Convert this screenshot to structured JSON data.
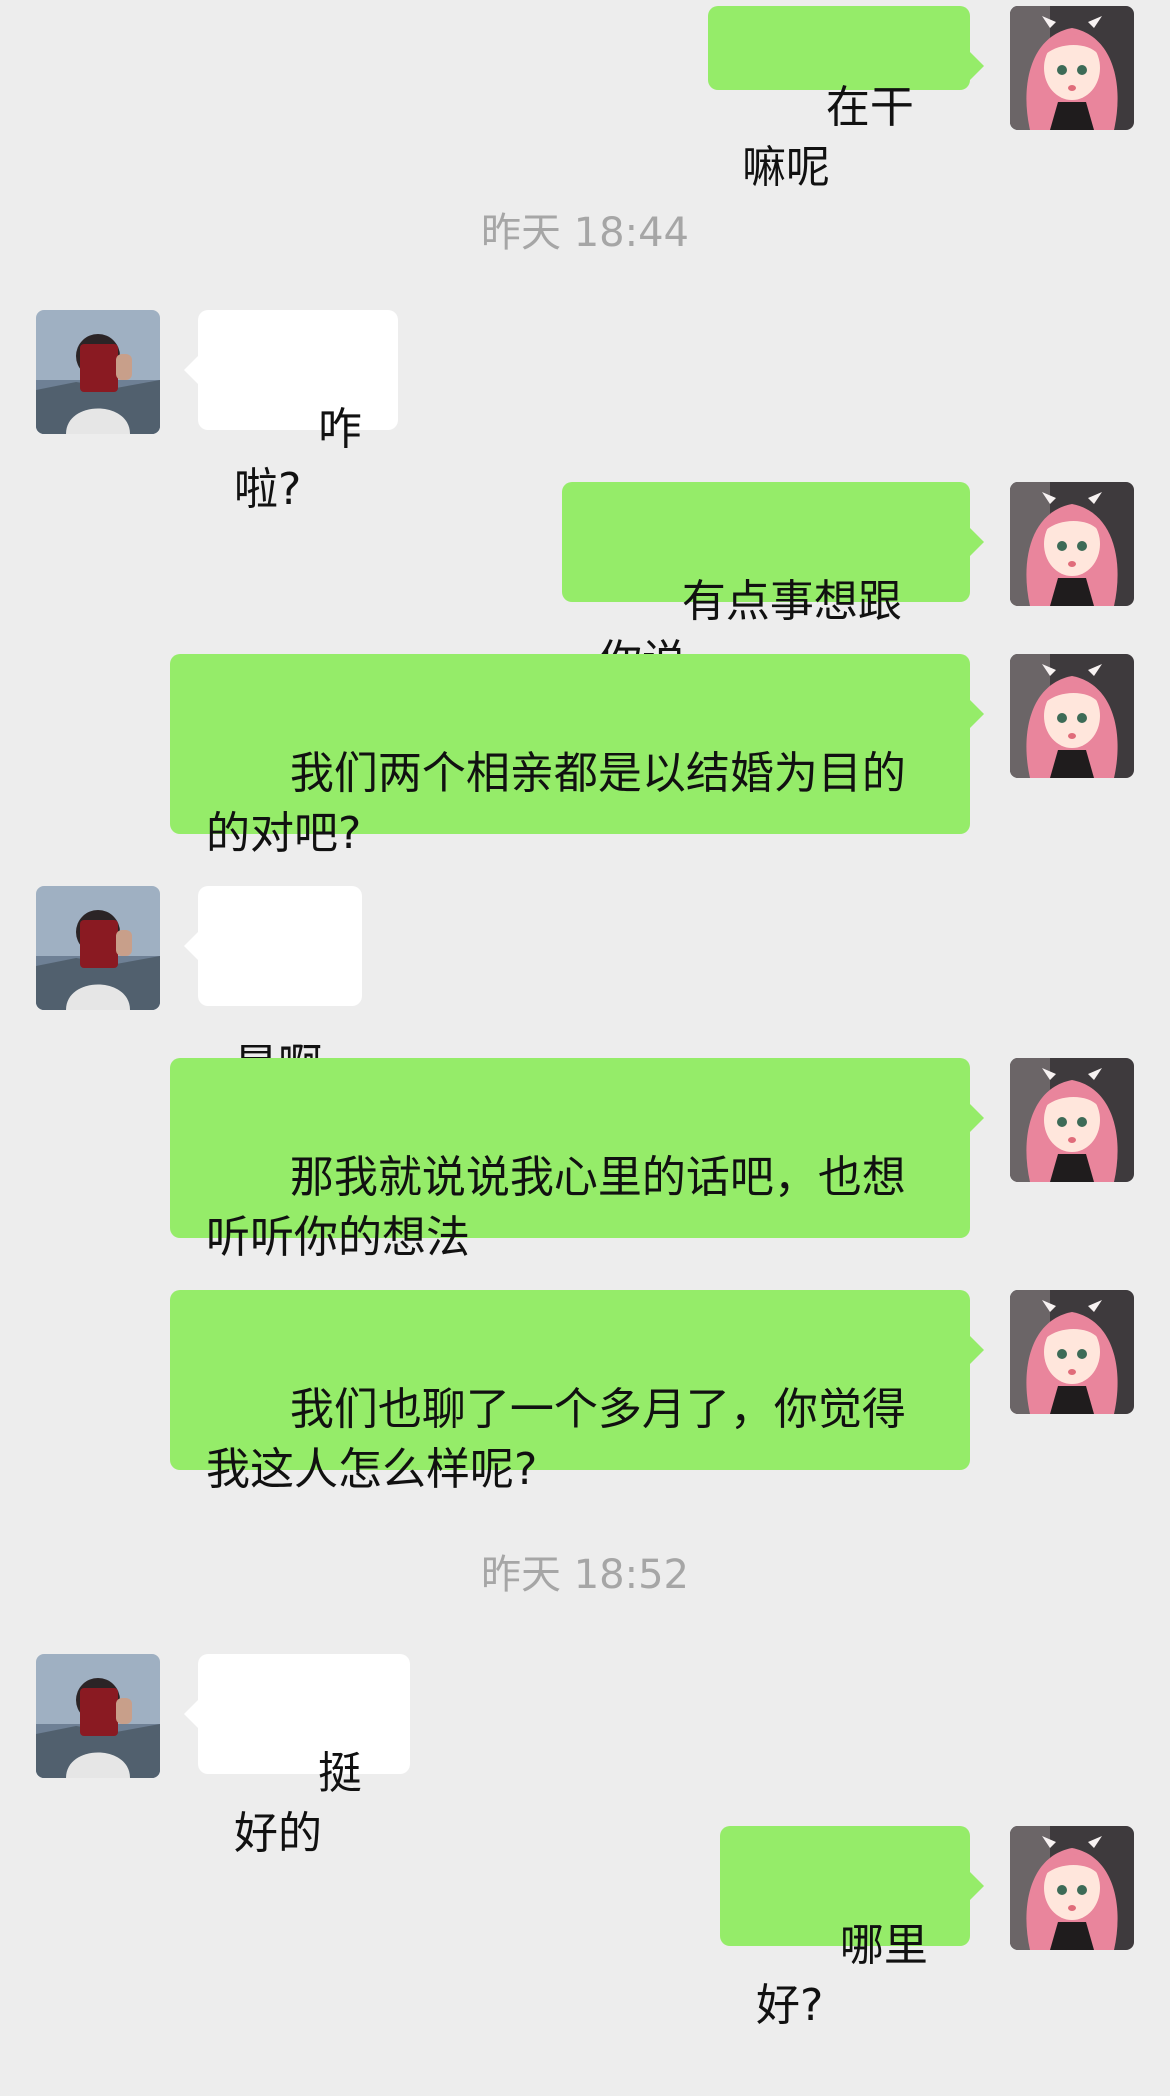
{
  "conversation": {
    "messages": [
      {
        "from": "me",
        "text": "在干嘛呢"
      },
      {
        "timestamp": "昨天 18:44"
      },
      {
        "from": "other",
        "text": "咋啦?"
      },
      {
        "from": "me",
        "text": "有点事想跟你说"
      },
      {
        "from": "me",
        "text": "我们两个相亲都是以结婚为目的的对吧?"
      },
      {
        "from": "other",
        "text": "是啊"
      },
      {
        "from": "me",
        "text": "那我就说说我心里的话吧，也想听听你的想法"
      },
      {
        "from": "me",
        "text": "我们也聊了一个多月了，你觉得我这人怎么样呢?"
      },
      {
        "timestamp": "昨天 18:52"
      },
      {
        "from": "other",
        "text": "挺好的"
      },
      {
        "from": "me",
        "text": "哪里好?"
      }
    ]
  },
  "colors": {
    "background": "#ededed",
    "outgoing_bubble": "#95ec69",
    "incoming_bubble": "#ffffff",
    "timestamp_text": "#a6a6a6"
  }
}
